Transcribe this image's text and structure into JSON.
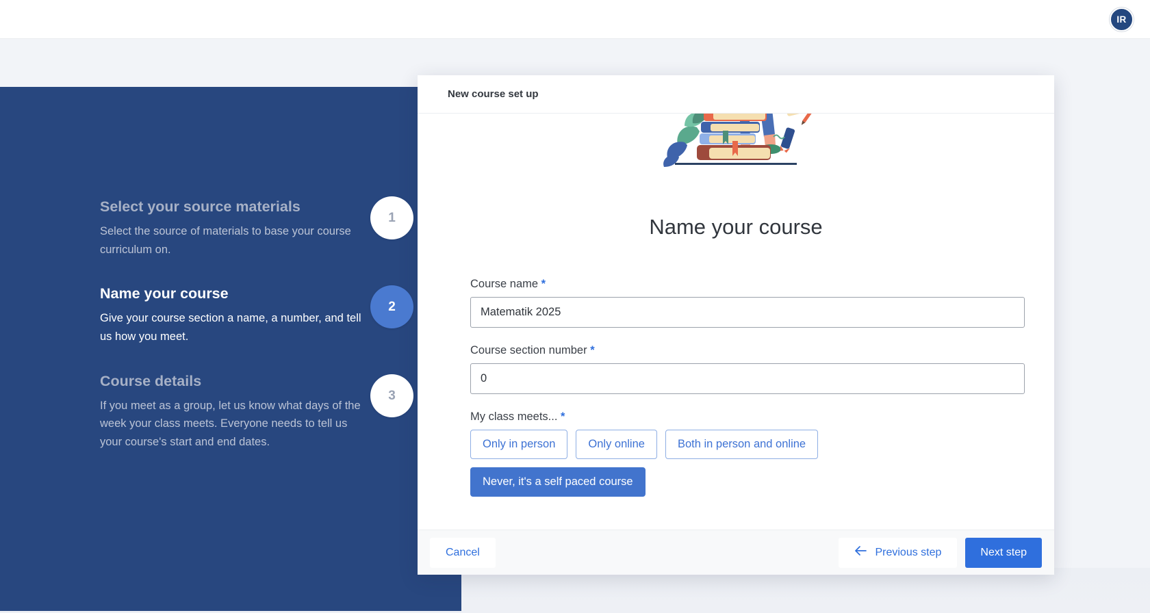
{
  "topbar": {
    "avatar_initials": "IR"
  },
  "stepper": {
    "steps": [
      {
        "number": "1",
        "title": "Select your source materials",
        "description": "Select the source of materials to base your course curriculum on.",
        "state": "inactive"
      },
      {
        "number": "2",
        "title": "Name your course",
        "description": "Give your course section a name, a number, and tell us how you meet.",
        "state": "active"
      },
      {
        "number": "3",
        "title": "Course details",
        "description": "If you meet as a group, let us know what days of the week your class meets. Everyone needs to tell us your course's start and end dates.",
        "state": "inactive"
      }
    ]
  },
  "modal": {
    "header_title": "New course set up",
    "title": "Name your course",
    "fields": {
      "course_name": {
        "label": "Course name",
        "required_marker": "*",
        "value": "Matematik 2025"
      },
      "course_section_number": {
        "label": "Course section number",
        "required_marker": "*",
        "value": "0"
      },
      "class_meets": {
        "label": "My class meets...",
        "required_marker": "*",
        "options": [
          {
            "label": "Only in person",
            "selected": false
          },
          {
            "label": "Only online",
            "selected": false
          },
          {
            "label": "Both in person and online",
            "selected": false
          },
          {
            "label": "Never, it's a self paced course",
            "selected": true
          }
        ]
      }
    },
    "footer": {
      "cancel_label": "Cancel",
      "previous_label": "Previous step",
      "next_label": "Next step"
    }
  },
  "colors": {
    "navy": "#28477f",
    "accent_blue": "#2f6fdd",
    "step_active": "#4a7ad0",
    "page_bg": "#f2f4f8"
  }
}
